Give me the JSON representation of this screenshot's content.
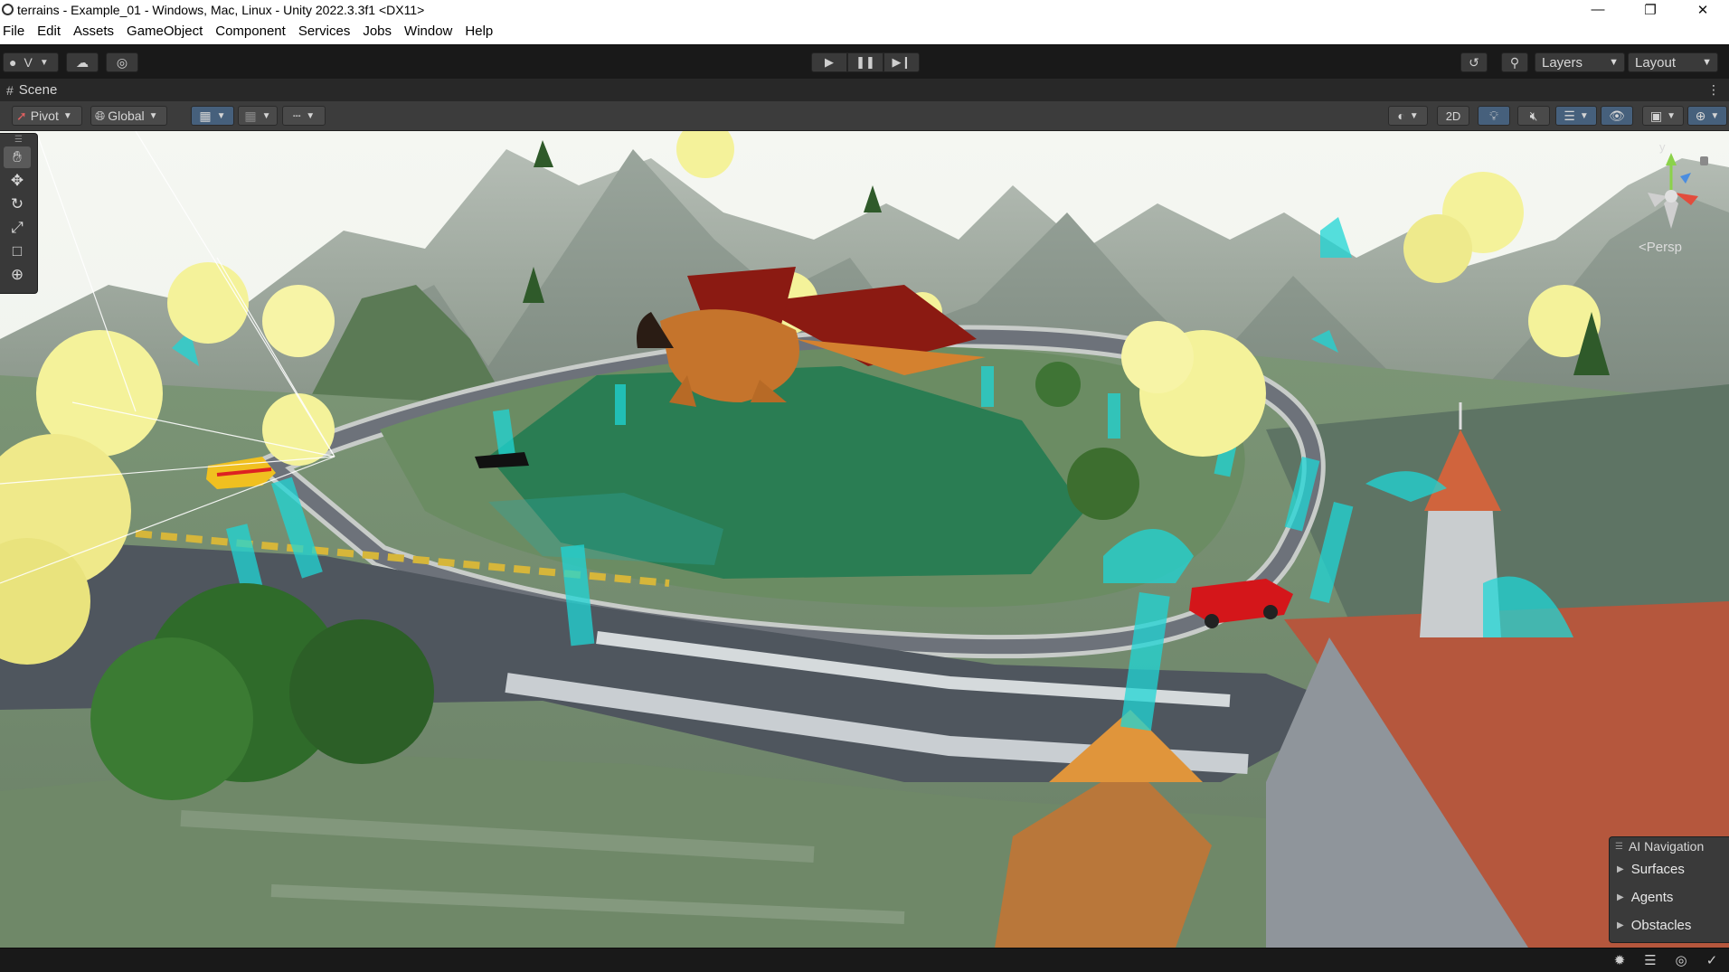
{
  "window": {
    "title": "terrains - Example_01 - Windows, Mac, Linux - Unity 2022.3.3f1 <DX11>",
    "controls": [
      "minimize-icon",
      "restore-icon",
      "close-icon"
    ]
  },
  "menu": {
    "items": [
      "File",
      "Edit",
      "Assets",
      "GameObject",
      "Component",
      "Services",
      "Jobs",
      "Window",
      "Help"
    ]
  },
  "toolbar": {
    "account_label": "V",
    "play_icons": [
      "play-icon",
      "pause-icon",
      "step-icon"
    ],
    "layers_label": "Layers",
    "layout_label": "Layout"
  },
  "scene_tab": {
    "label": "Scene"
  },
  "scene_toolbar": {
    "pivot_label": "Pivot",
    "global_label": "Global",
    "mode_2d_label": "2D"
  },
  "viewport": {
    "camera_mode_label": "<Persp",
    "gizmo_axis_y": "y",
    "tools": [
      "hand-tool-icon",
      "move-tool-icon",
      "rotate-tool-icon",
      "scale-tool-icon",
      "rect-tool-icon",
      "transform-tool-icon"
    ],
    "active_tool": "hand-tool-icon"
  },
  "ai_navigation": {
    "title": "AI Navigation",
    "items": [
      "Surfaces",
      "Agents",
      "Obstacles"
    ]
  },
  "colors": {
    "editor_dark": "#191919",
    "toolbar_grey": "#3c3c3c",
    "sky": "#f1f4ef",
    "grass": "#6f8a66",
    "navmesh_cyan": "#1fd6d6",
    "water_green": "#1f7a50",
    "tree_yellow": "#f4f29a"
  }
}
